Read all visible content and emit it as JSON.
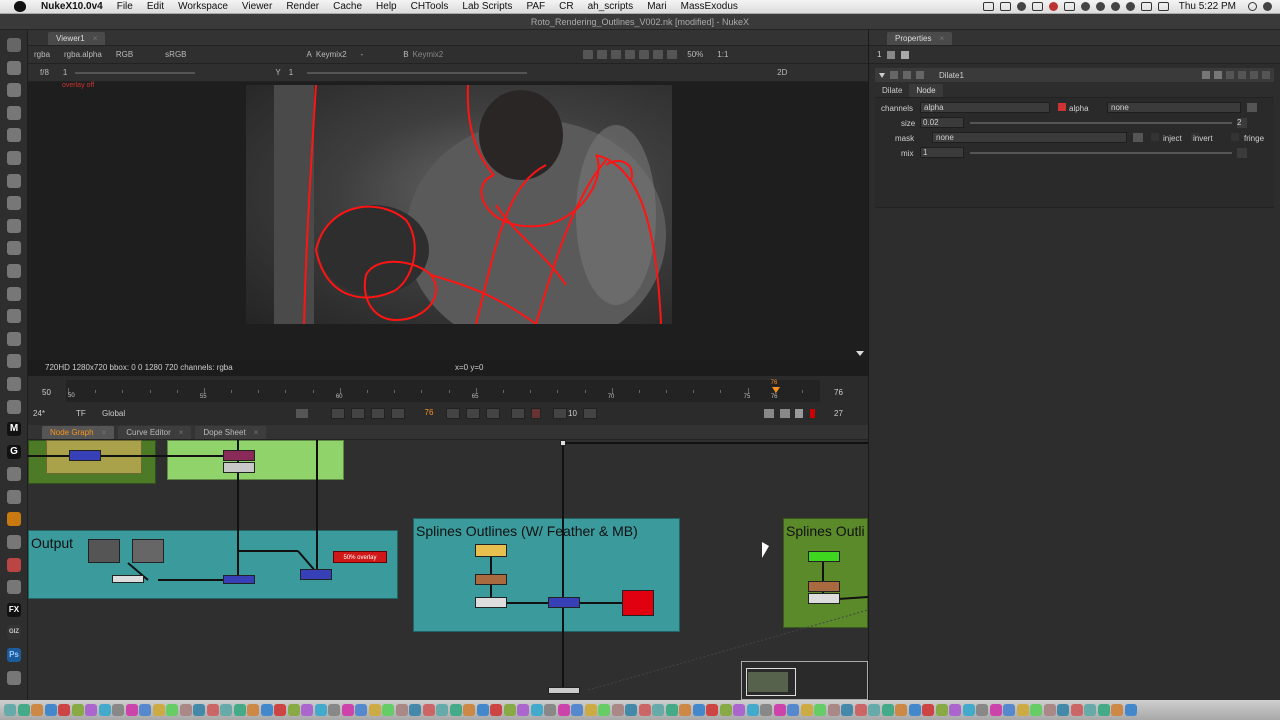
{
  "menubar": {
    "app_name": "NukeX10.0v4",
    "items": [
      "File",
      "Edit",
      "Workspace",
      "Viewer",
      "Render",
      "Cache",
      "Help",
      "CHTools",
      "Lab Scripts",
      "PAF",
      "CR",
      "ah_scripts",
      "Mari",
      "MassExodus"
    ],
    "clock": "Thu 5:22 PM"
  },
  "window_title": "Roto_Rendering_Outlines_V002.nk [modified] - NukeX",
  "viewer": {
    "tab_label": "Viewer1",
    "channels": "rgba",
    "channel_alpha": "rgba.alpha",
    "display": "RGB",
    "lut": "sRGB",
    "input_a_label": "A",
    "input_a": "Keymix2",
    "input_a_op": "-",
    "input_b_label": "B",
    "input_b": "Keymix2",
    "zoom": "50%",
    "ratio": "1:1",
    "fstop": "f/8",
    "gain_value": "1",
    "gamma_label": "Y",
    "gamma_value": "1",
    "view_mode": "2D",
    "overlay_text": "overlay off",
    "info_left": "720HD 1280x720  bbox: 0 0 1280 720 channels: rgba",
    "info_coords": "x=0 y=0"
  },
  "timeline": {
    "start_frame": "50",
    "end_frame": "76",
    "in_point": "50",
    "ticks": [
      "50",
      "55",
      "60",
      "65",
      "70",
      "75",
      "76"
    ],
    "current_frame_marker": "76",
    "current_frame_fraction": 0.96,
    "fps": "24*",
    "tf": "TF",
    "scope": "Global",
    "current_frame": "76",
    "increment": "10",
    "last_frame": "27"
  },
  "nodegraph": {
    "tabs": [
      "Node Graph",
      "Curve Editor",
      "Dope Sheet"
    ],
    "backdrops": {
      "output_title": "Output",
      "splines_fmb_title": "Splines Outlines (W/ Feather & MB)",
      "splines_title": "Splines Outli"
    },
    "overlay_badge": "50% overlay"
  },
  "properties": {
    "panel_title": "Properties",
    "tab_count": "1",
    "node_name": "Dilate1",
    "tabs": [
      "Dilate",
      "Node"
    ],
    "channels_label": "channels",
    "channels_value": "alpha",
    "alpha_check_label": "alpha",
    "channels_extra": "none",
    "size_label": "size",
    "size_value": "0.02",
    "size_scale": "2",
    "mask_label": "mask",
    "mask_value": "none",
    "inject_label": "inject",
    "invert_label": "invert",
    "fringe_label": "fringe",
    "mix_label": "mix",
    "mix_value": "1"
  }
}
